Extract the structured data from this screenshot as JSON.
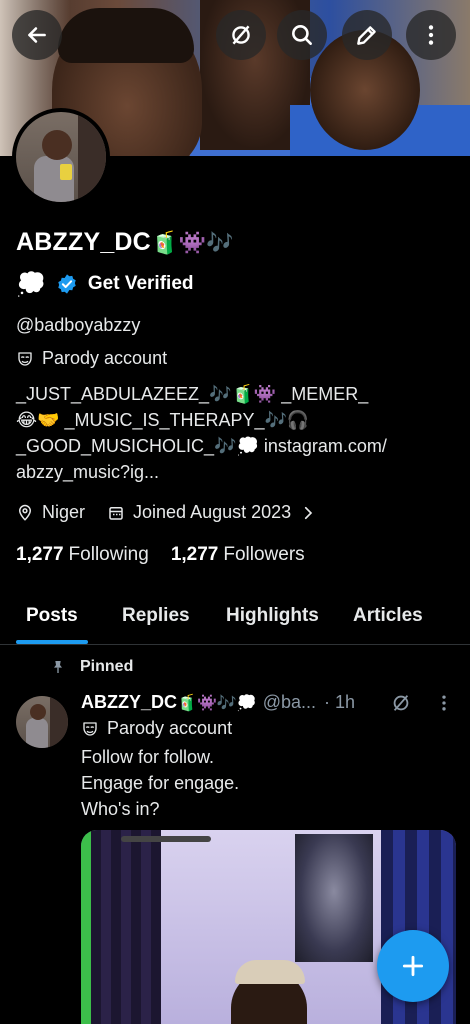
{
  "profile": {
    "display_name": "ABZZY_DC",
    "name_emojis": "🧃👾🎶",
    "status_emoji": "💭",
    "get_verified_label": "Get Verified",
    "handle": "@badboyabzzy",
    "parody_label": "Parody account",
    "bio_line1": "_JUST_ABDULAZEEZ_🎶🧃👾 _MEMER_",
    "bio_line2": "😂🤝 _MUSIC_IS_THERAPY_🎶🎧",
    "bio_line3": "_GOOD_MUSICHOLIC_🎶💭 instagram.com/",
    "bio_line4": "abzzy_music?ig...",
    "location": "Niger",
    "joined": "Joined August 2023",
    "following_count": "1,277",
    "following_label": "Following",
    "followers_count": "1,277",
    "followers_label": "Followers"
  },
  "tabs": [
    {
      "label": "Posts",
      "active": true
    },
    {
      "label": "Replies"
    },
    {
      "label": "Highlights"
    },
    {
      "label": "Articles"
    }
  ],
  "post": {
    "pinned_label": "Pinned",
    "author_name": "ABZZY_DC",
    "author_emojis": "🧃👾🎶💭",
    "author_handle": "@ba...",
    "time": "· 1h",
    "parody_label": "Parody account",
    "line1": "Follow for follow.",
    "line2": "Engage for engage.",
    "line3": "Who's in?"
  },
  "icons": {
    "back": "back-arrow-icon",
    "no_sign": "no-sign-icon",
    "search": "search-icon",
    "edit": "edit-icon",
    "more": "more-vertical-icon",
    "verified_badge": "verified-badge-icon",
    "mask": "mask-icon",
    "location": "location-icon",
    "calendar": "calendar-icon",
    "chevron": "chevron-right-icon",
    "pin": "pin-icon",
    "compose": "plus-icon"
  },
  "colors": {
    "accent": "#1d9bf0",
    "background": "#000000",
    "text": "#e7e9ea",
    "muted": "#8b98a5"
  }
}
